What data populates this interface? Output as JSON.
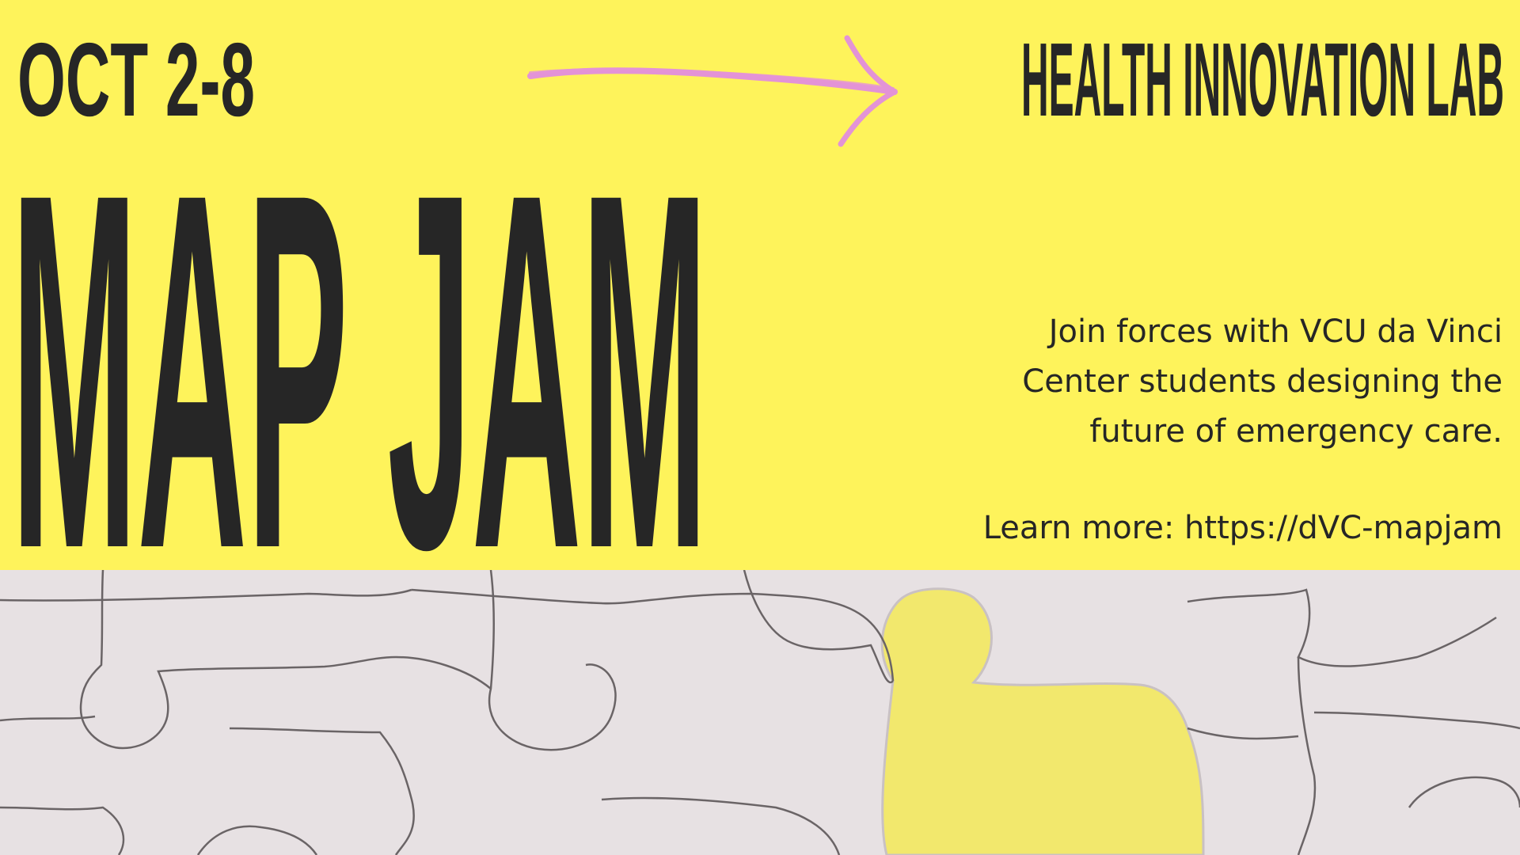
{
  "header": {
    "date": "OCT 2-8",
    "organization": "HEALTH INNOVATION LAB"
  },
  "title": "MAP JAM",
  "description": [
    "Join forces with VCU da Vinci",
    "Center students designing the",
    "future of emergency care."
  ],
  "learn_more": "Learn more: https://dVC-mapjam",
  "colors": {
    "background": "#fef35b",
    "text": "#262626",
    "arrow": "#e393d6",
    "puzzle_piece": "#e7e1e3",
    "puzzle_hole": "#f2e86d"
  },
  "icons": {
    "arrow": "right-arrow-icon",
    "puzzle": "puzzle-pieces-image"
  }
}
